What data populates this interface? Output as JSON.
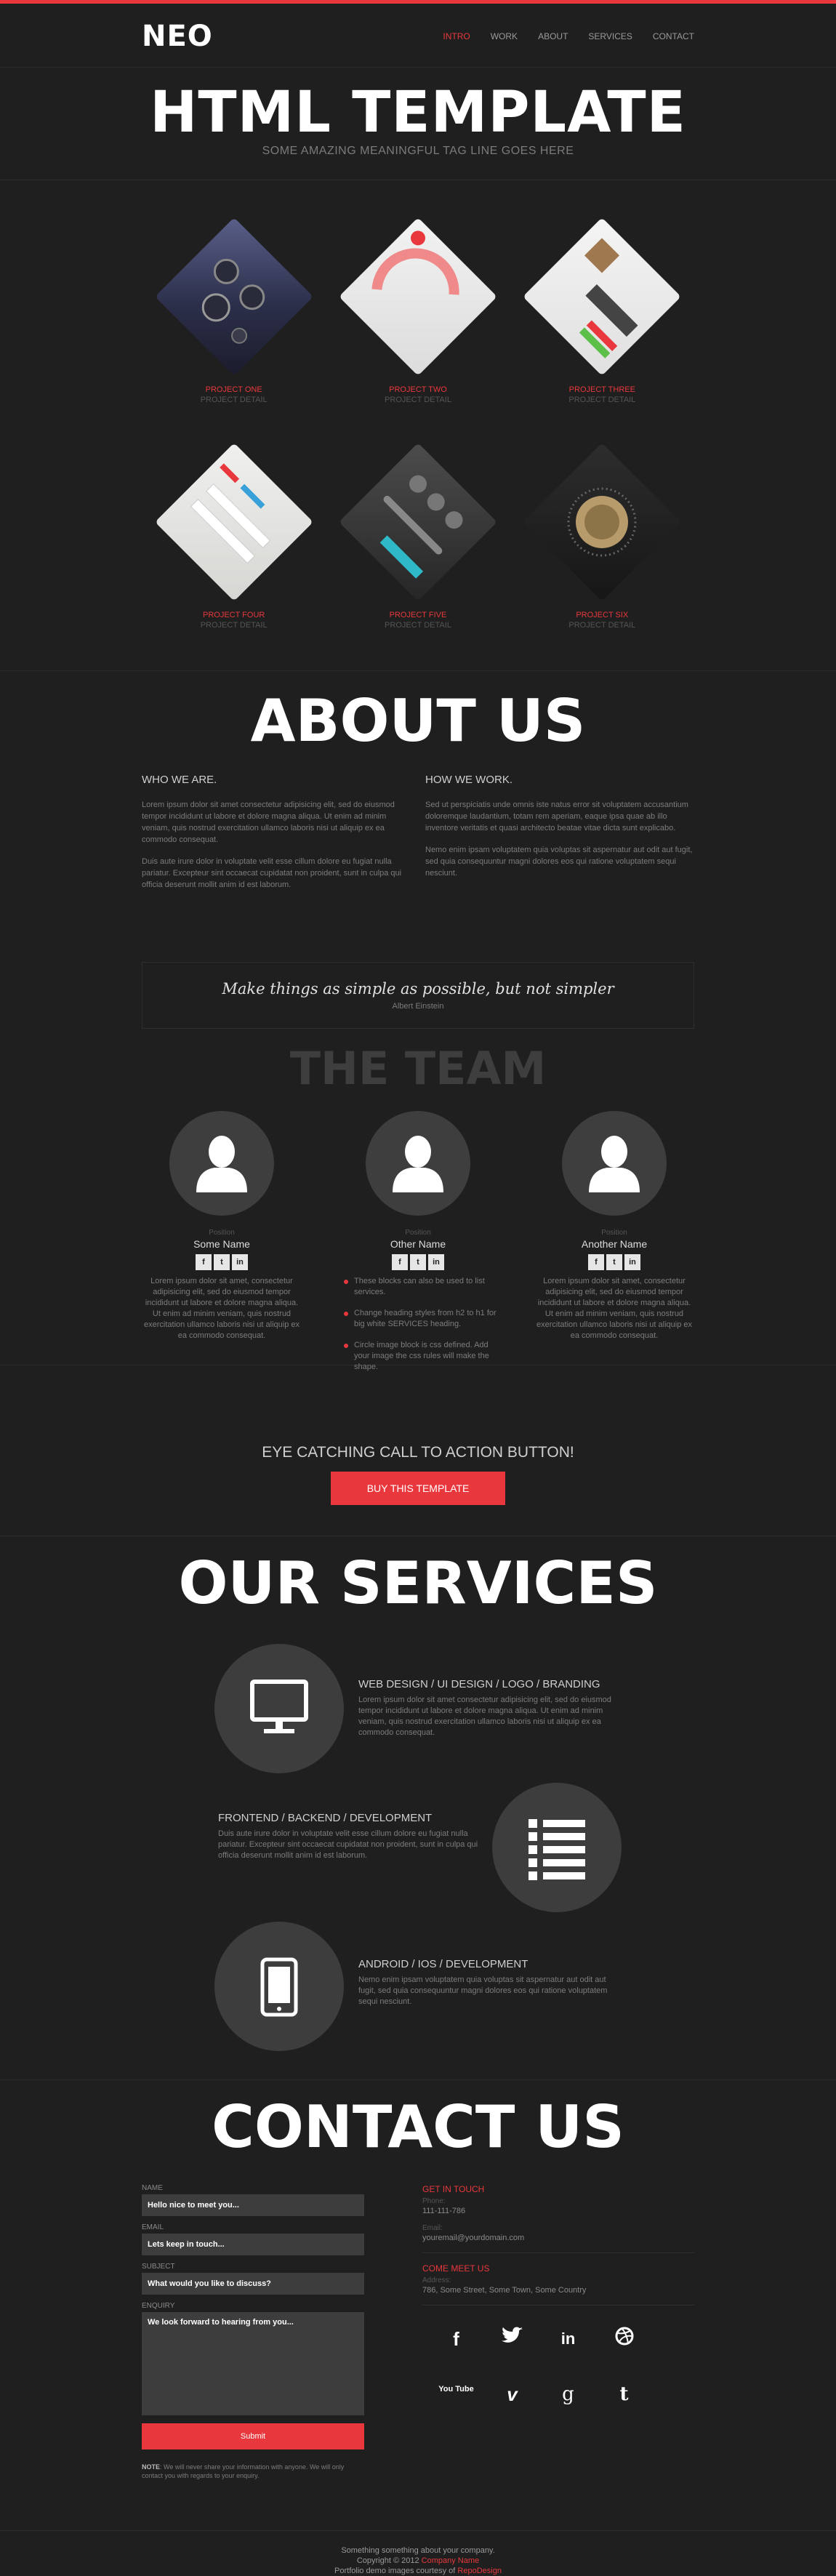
{
  "brand": {
    "logo": "NEO",
    "accent_color": "#e8383d"
  },
  "nav": {
    "items": [
      "INTRO",
      "WORK",
      "ABOUT",
      "SERVICES",
      "CONTACT"
    ],
    "active": "INTRO"
  },
  "hero": {
    "title": "HTML TEMPLATE",
    "tagline": "SOME AMAZING MEANINGFUL TAG LINE GOES HERE"
  },
  "portfolio": {
    "projects": [
      {
        "title": "PROJECT ONE",
        "detail": "PROJECT DETAIL"
      },
      {
        "title": "PROJECT TWO",
        "detail": "PROJECT DETAIL"
      },
      {
        "title": "PROJECT THREE",
        "detail": "PROJECT DETAIL"
      },
      {
        "title": "PROJECT FOUR",
        "detail": "PROJECT DETAIL"
      },
      {
        "title": "PROJECT FIVE",
        "detail": "PROJECT DETAIL"
      },
      {
        "title": "PROJECT SIX",
        "detail": "PROJECT DETAIL"
      }
    ]
  },
  "about": {
    "title": "ABOUT US",
    "who": {
      "heading": "WHO WE ARE.",
      "p1": "Lorem ipsum dolor sit amet consectetur adipisicing elit, sed do eiusmod tempor incididunt ut labore et dolore magna aliqua. Ut enim ad minim veniam, quis nostrud exercitation ullamco laboris nisi ut aliquip ex ea commodo consequat.",
      "p2": "Duis aute irure dolor in voluptate velit esse cillum dolore eu fugiat nulla pariatur. Excepteur sint occaecat cupidatat non proident, sunt in culpa qui officia deserunt mollit anim id est laborum."
    },
    "how": {
      "heading": "HOW WE WORK.",
      "p1": "Sed ut perspiciatis unde omnis iste natus error sit voluptatem accusantium doloremque laudantium, totam rem aperiam, eaque ipsa quae ab illo inventore veritatis et quasi architecto beatae vitae dicta sunt explicabo.",
      "p2": "Nemo enim ipsam voluptatem quia voluptas sit aspernatur aut odit aut fugit, sed quia consequuntur magni dolores eos qui ratione voluptatem sequi nesciunt."
    },
    "quote": {
      "text": "Make things as simple as possible, but not simpler",
      "author": "Albert Einstein"
    }
  },
  "team": {
    "title": "THE TEAM",
    "members": [
      {
        "position": "Position",
        "name": "Some Name",
        "bio": "Lorem ipsum dolor sit amet, consectetur adipisicing elit, sed do eiusmod tempor incididunt ut labore et dolore magna aliqua. Ut enim ad minim veniam, quis nostrud exercitation ullamco laboris nisi ut aliquip ex ea commodo consequat."
      },
      {
        "position": "Position",
        "name": "Other Name",
        "bullets": [
          "These blocks can also be used to list services.",
          "Change heading styles from h2 to h1 for big white SERVICES heading.",
          "Circle image block is css defined. Add your image the css rules will make the shape."
        ]
      },
      {
        "position": "Position",
        "name": "Another Name",
        "bio": "Lorem ipsum dolor sit amet, consectetur adipisicing elit, sed do eiusmod tempor incididunt ut labore et dolore magna aliqua. Ut enim ad minim veniam, quis nostrud exercitation ullamco laboris nisi ut aliquip ex ea commodo consequat."
      }
    ],
    "social_icons": [
      "f",
      "t",
      "in"
    ]
  },
  "cta": {
    "heading": "EYE CATCHING CALL TO ACTION BUTTON!",
    "button": "BUY THIS TEMPLATE"
  },
  "services": {
    "title": "OUR SERVICES",
    "items": [
      {
        "icon": "monitor-icon",
        "heading": "WEB DESIGN / UI DESIGN / LOGO / BRANDING",
        "text": "Lorem ipsum dolor sit amet consectetur adipisicing elit, sed do eiusmod tempor incididunt ut labore et dolore magna aliqua. Ut enim ad minim veniam, quis nostrud exercitation ullamco laboris nisi ut aliquip ex ea commodo consequat."
      },
      {
        "icon": "list-icon",
        "heading": "FRONTEND / BACKEND / DEVELOPMENT",
        "text": "Duis aute irure dolor in voluptate velit esse cillum dolore eu fugiat nulla pariatur. Excepteur sint occaecat cupidatat non proident, sunt in culpa qui officia deserunt mollit anim id est laborum."
      },
      {
        "icon": "phone-icon",
        "heading": "ANDROID / IOS / DEVELOPMENT",
        "text": "Nemo enim ipsam voluptatem quia voluptas sit aspernatur aut odit aut fugit, sed quia consequuntur magni dolores eos qui ratione voluptatem sequi nesciunt."
      }
    ]
  },
  "contact": {
    "title": "CONTACT US",
    "form": {
      "name_label": "NAME",
      "name_value": "Hello nice to meet you...",
      "email_label": "EMAIL",
      "email_value": "Lets keep in touch...",
      "subject_label": "SUBJECT",
      "subject_value": "What would you like to discuss?",
      "enquiry_label": "ENQUIRY",
      "enquiry_value": "We look forward to hearing from you...",
      "submit": "Submit",
      "note_bold": "NOTE",
      "note_text": ": We will never share your information with anyone. We will only contact you with regards to your enquiry."
    },
    "info": {
      "get_in_touch": "GET IN TOUCH",
      "phone_label": "Phone:",
      "phone": "111-111-786",
      "email_label": "Email:",
      "email": "youremail@yourdomain.com",
      "come_meet": "COME MEET US",
      "address_label": "Address:",
      "address": "786, Some Street, Some Town, Some Country"
    },
    "social": [
      "f",
      "t",
      "in",
      "dribbble",
      "You Tube",
      "v",
      "g",
      "t"
    ]
  },
  "footer": {
    "line1": "Something something about your company.",
    "copyright_prefix": "Copyright © 2012",
    "company": "Company Name",
    "credit_prefix": "Portfolio demo images courtesy of",
    "credit": "RepoDesign"
  }
}
